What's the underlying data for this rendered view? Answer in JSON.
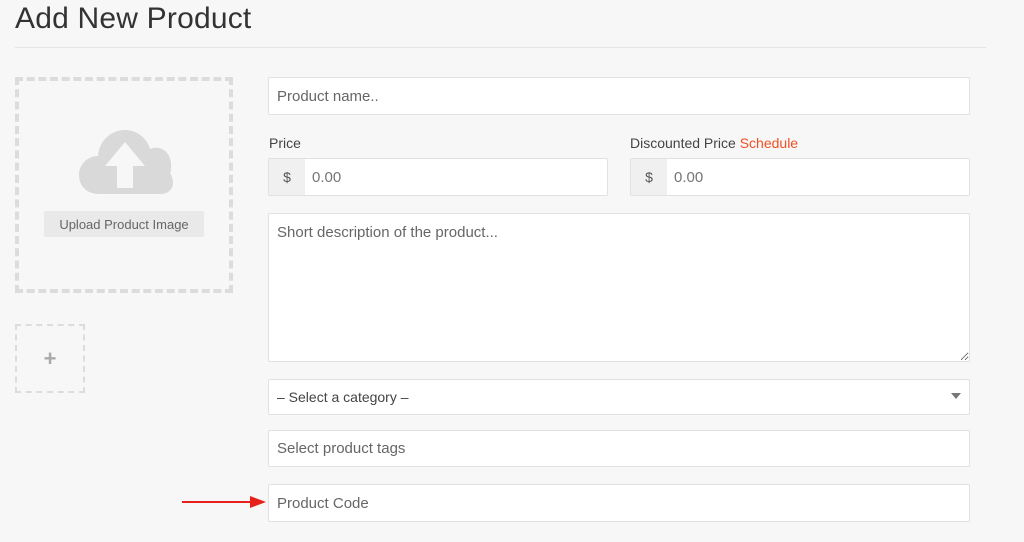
{
  "page": {
    "title": "Add New Product"
  },
  "image_upload": {
    "button_label": "Upload Product Image",
    "icon": "cloud-upload-icon"
  },
  "gallery": {
    "add_symbol": "+",
    "icon": "plus-icon"
  },
  "form": {
    "name": {
      "placeholder": "Product name.."
    },
    "price": {
      "label": "Price",
      "currency": "$",
      "placeholder": "0.00"
    },
    "discount": {
      "label": "Discounted Price",
      "schedule_link": "Schedule",
      "currency": "$",
      "placeholder": "0.00"
    },
    "description": {
      "placeholder": "Short description of the product..."
    },
    "category": {
      "selected": "– Select a category –"
    },
    "tags": {
      "placeholder": "Select product tags"
    },
    "code": {
      "placeholder": "Product Code"
    }
  },
  "colors": {
    "accent": "#f05025",
    "annotation_arrow": "#e8201b"
  }
}
